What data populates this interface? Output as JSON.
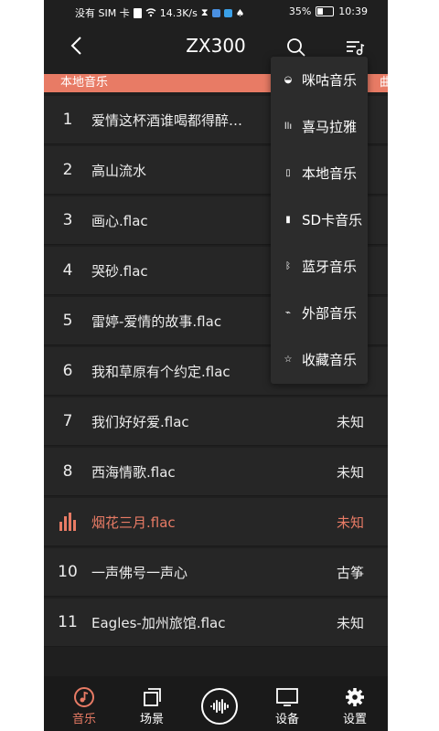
{
  "status_bar": {
    "carrier": "没有 SIM 卡",
    "speed": "14.3K/s",
    "battery": "35%",
    "time": "10:39"
  },
  "header": {
    "title": "ZX300"
  },
  "section": {
    "label": "本地音乐",
    "right_label": "曲"
  },
  "songs": [
    {
      "index": "1",
      "title": "爱情这杯酒谁喝都得醉…",
      "genre": ""
    },
    {
      "index": "2",
      "title": "高山流水",
      "genre": ""
    },
    {
      "index": "3",
      "title": "画心.flac",
      "genre": ""
    },
    {
      "index": "4",
      "title": "哭砂.flac",
      "genre": ""
    },
    {
      "index": "5",
      "title": "雷婷-爱情的故事.flac",
      "genre": ""
    },
    {
      "index": "6",
      "title": "我和草原有个约定.flac",
      "genre": ""
    },
    {
      "index": "7",
      "title": "我们好好爱.flac",
      "genre": "未知"
    },
    {
      "index": "8",
      "title": "西海情歌.flac",
      "genre": "未知"
    },
    {
      "index": "",
      "title": "烟花三月.flac",
      "genre": "未知",
      "playing": true
    },
    {
      "index": "10",
      "title": "一声佛号一声心",
      "genre": "古筝"
    },
    {
      "index": "11",
      "title": "Eagles-加州旅馆.flac",
      "genre": "未知"
    }
  ],
  "source_menu": [
    {
      "label": "咪咕音乐",
      "icon": "migu-icon"
    },
    {
      "label": "喜马拉雅",
      "icon": "ximalaya-icon"
    },
    {
      "label": "本地音乐",
      "icon": "phone-icon"
    },
    {
      "label": "SD卡音乐",
      "icon": "sdcard-icon"
    },
    {
      "label": "蓝牙音乐",
      "icon": "bluetooth-icon"
    },
    {
      "label": "外部音乐",
      "icon": "external-icon"
    },
    {
      "label": "收藏音乐",
      "icon": "star-icon"
    }
  ],
  "nav": {
    "music": "音乐",
    "scene": "场景",
    "device": "设备",
    "settings": "设置"
  },
  "colors": {
    "accent": "#e87b65",
    "background": "#1f1f1f"
  }
}
